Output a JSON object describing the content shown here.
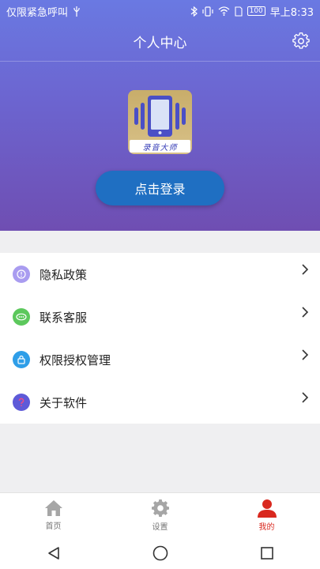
{
  "status_bar": {
    "left_text": "仅限紧急呼叫",
    "battery": "100",
    "time": "早上8:33"
  },
  "header": {
    "title": "个人中心"
  },
  "logo": {
    "text": "录音大师"
  },
  "login": {
    "label": "点击登录"
  },
  "menu": {
    "items": [
      {
        "label": "隐私政策",
        "color": "#a99cf0"
      },
      {
        "label": "联系客服",
        "color": "#5cc85c"
      },
      {
        "label": "权限授权管理",
        "color": "#2e9ee8"
      },
      {
        "label": "关于软件",
        "color": "#5e5ad8"
      }
    ]
  },
  "bottom_nav": {
    "items": [
      {
        "label": "首页"
      },
      {
        "label": "设置"
      },
      {
        "label": "我的"
      }
    ],
    "active_color": "#d9281e"
  }
}
